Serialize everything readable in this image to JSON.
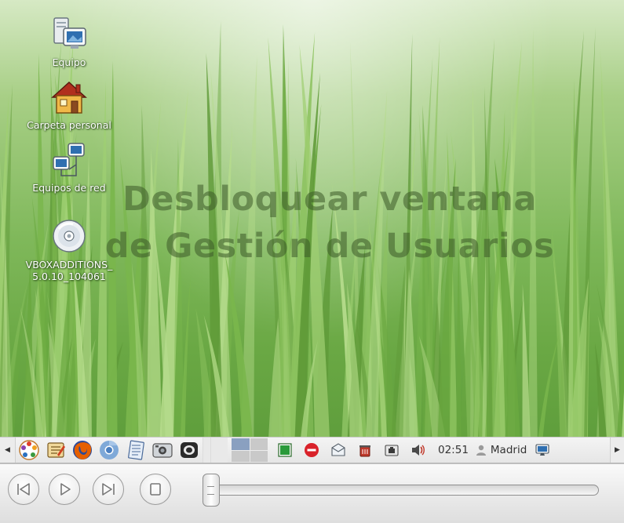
{
  "desktop": {
    "icons": [
      {
        "label": "Equipo",
        "icon": "computer-icon"
      },
      {
        "label": "Carpeta personal",
        "icon": "home-folder-icon"
      },
      {
        "label": "Equipos de red",
        "icon": "network-icon"
      },
      {
        "label": "VBOXADDITIONS_\n5.0.10_104061",
        "icon": "cd-icon"
      }
    ],
    "overlay_title": "Desbloquear ventana de Gestión de Usuarios"
  },
  "taskbar": {
    "launchers": [
      {
        "icon": "app-menu-icon"
      },
      {
        "icon": "text-editor-icon"
      },
      {
        "icon": "firefox-icon"
      },
      {
        "icon": "chromium-icon"
      },
      {
        "icon": "notes-icon"
      },
      {
        "icon": "screenshot-icon"
      },
      {
        "icon": "video-player-icon"
      }
    ],
    "workspaces": 4,
    "active_workspace": 1,
    "tray": [
      {
        "icon": "green-square-icon"
      },
      {
        "icon": "stop-sign-icon"
      },
      {
        "icon": "mail-notify-icon"
      },
      {
        "icon": "trash-update-icon"
      },
      {
        "icon": "network-tray-icon"
      },
      {
        "icon": "volume-icon"
      }
    ],
    "clock": "02:51",
    "user_name": "Madrid",
    "user_icon": "user-icon",
    "display_icon": "display-icon"
  },
  "media": {
    "buttons": [
      "previous-icon",
      "play-icon",
      "next-icon",
      "stop-icon"
    ],
    "seek_position": 0
  },
  "colors": {
    "grass_light": "#d6e9c4",
    "grass_dark": "#5f9e3c",
    "overlay_text": "#3c5a28",
    "firefox_orange": "#e66000",
    "stop_red": "#d9222a"
  }
}
